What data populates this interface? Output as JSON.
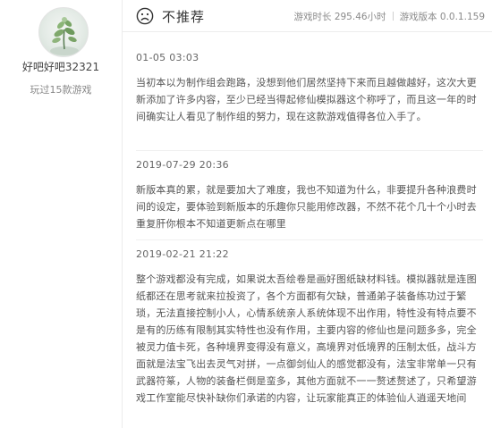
{
  "user": {
    "name": "好吧好吧32321",
    "games_played": "玩过15款游戏"
  },
  "header": {
    "icon": "sad-face-icon",
    "verdict": "不推荐",
    "playtime": "游戏时长 295.46小时",
    "version": "游戏版本 0.0.1.159"
  },
  "reviews": [
    {
      "date": "01-05 03:03",
      "text": "当初本以为制作组会跑路，没想到他们居然坚持下来而且越做越好，这次大更新添加了许多内容，至少已经当得起修仙模拟器这个称呼了，而且这一年的时间确实让人看见了制作组的努力，现在这款游戏值得各位入手了。"
    },
    {
      "date": "2019-07-29 20:36",
      "text": "新版本真的累，就是要加大了难度，我也不知道为什么，非要提升各种浪费时间的设定，要体验到新版本的乐趣你只能用修改器，不然不花个几十个小时去重复肝你根本不知道更新点在哪里"
    },
    {
      "date": "2019-02-21 21:22",
      "text": "整个游戏都没有完成，如果说太吾绘卷是画好图纸缺材料钱。模拟器就是连图纸都还在思考就来拉投资了，各个方面都有欠缺，普通弟子装备练功过于繁琐，无法直接控制小人，心情系统亲人系统体现不出作用，特性没有特点要不是有的历练有限制其实特性也没有作用，主要内容的修仙也是问题多多，完全被灵力值卡死，各种境界变得没有意义，高境界对低境界的压制太低，战斗方面就是法宝飞出去灵气对拼，一点御剑仙人的感觉都没有，法宝非常单一只有武器符篆，人物的装备栏倒是蛮多，其他方面就不一一赘述赘述了，只希望游戏工作室能尽快补缺你们承诺的内容，让玩家能真正的体验仙人逍遥天地间"
    }
  ],
  "colors": {
    "text_main": "#555555",
    "text_meta": "#8a8a8a",
    "divider": "#ececec"
  }
}
